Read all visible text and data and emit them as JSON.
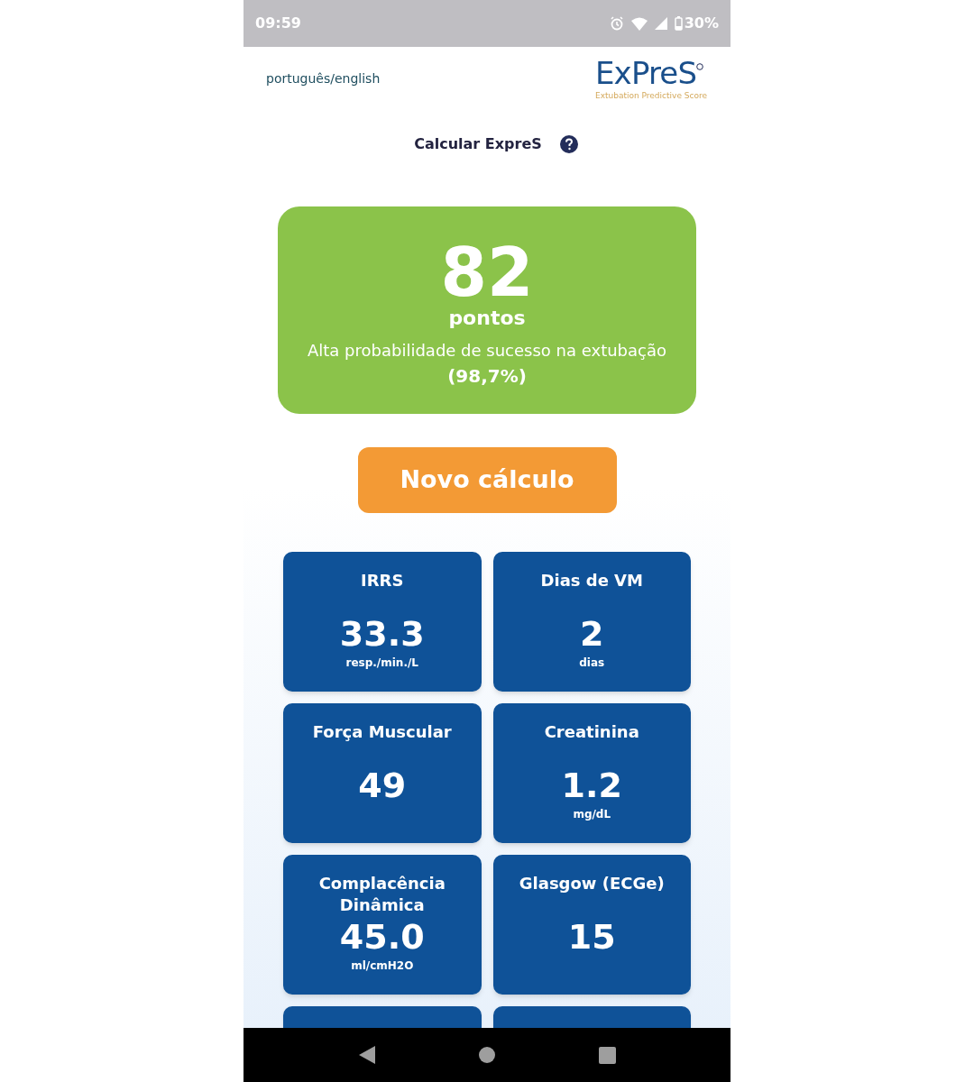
{
  "status_bar": {
    "time": "09:59",
    "battery": "30%"
  },
  "header": {
    "language_link": "português/english",
    "logo": {
      "title": "ExPreS",
      "subtitle": "Extubation Predictive Score"
    }
  },
  "page_title": "Calcular ExpreS",
  "result": {
    "score": "82",
    "unit": "pontos",
    "message": "Alta probabilidade de sucesso na extubação",
    "probability": "(98,7%)",
    "color": "#8bc34a"
  },
  "new_calc_button": "Novo cálculo",
  "metrics": [
    {
      "label": "IRRS",
      "value": "33.3",
      "unit": "resp./min./L"
    },
    {
      "label": "Dias de VM",
      "value": "2",
      "unit": "dias"
    },
    {
      "label": "Força Muscular",
      "value": "49"
    },
    {
      "label": "Creatinina",
      "value": "1.2",
      "unit": "mg/dL"
    },
    {
      "label": "Complacência Dinâmica",
      "value": "45.0",
      "unit": "ml/cmH2O"
    },
    {
      "label": "Glasgow (ECGe)",
      "value": "15"
    },
    {
      "kind": "cut"
    },
    {
      "kind": "cut"
    }
  ]
}
